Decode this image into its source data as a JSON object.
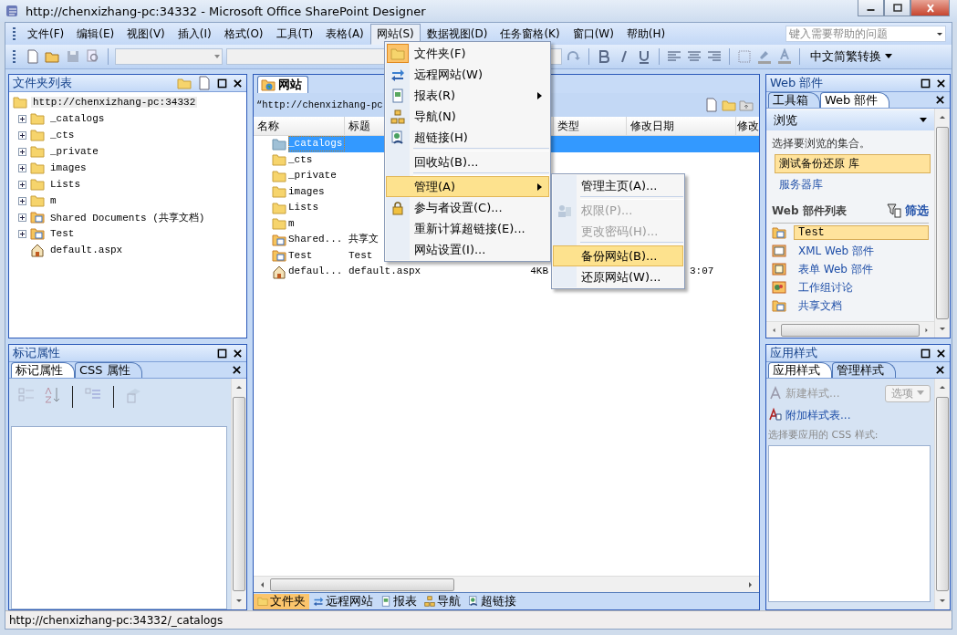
{
  "window": {
    "title": "http://chenxizhang-pc:34332 - Microsoft Office SharePoint Designer"
  },
  "menu_bar": {
    "items": [
      {
        "label": "文件(F)",
        "selected": false
      },
      {
        "label": "编辑(E)",
        "selected": false
      },
      {
        "label": "视图(V)",
        "selected": false
      },
      {
        "label": "插入(I)",
        "selected": false
      },
      {
        "label": "格式(O)",
        "selected": false
      },
      {
        "label": "工具(T)",
        "selected": false
      },
      {
        "label": "表格(A)",
        "selected": false
      },
      {
        "label": "网站(S)",
        "selected": true
      },
      {
        "label": "数据视图(D)",
        "selected": false
      },
      {
        "label": "任务窗格(K)",
        "selected": false
      },
      {
        "label": "窗口(W)",
        "selected": false
      },
      {
        "label": "帮助(H)",
        "selected": false
      }
    ],
    "help_search": {
      "placeholder": "键入需要帮助的问题"
    }
  },
  "toolbar": {
    "language_button": "中文简繁转换"
  },
  "folder_list": {
    "title": "文件夹列表",
    "tree": {
      "label": "http://chenxizhang-pc:34332",
      "selected": true,
      "children": [
        {
          "label": "_catalogs",
          "kind": "folder",
          "expanded": false
        },
        {
          "label": "_cts",
          "kind": "folder",
          "expanded": false
        },
        {
          "label": "_private",
          "kind": "folder",
          "expanded": false
        },
        {
          "label": "images",
          "kind": "folder",
          "expanded": false
        },
        {
          "label": "Lists",
          "kind": "folder",
          "expanded": false
        },
        {
          "label": "m",
          "kind": "folder",
          "expanded": false
        },
        {
          "label": "Shared Documents (共享文档)",
          "kind": "library",
          "expanded": false
        },
        {
          "label": "Test",
          "kind": "library",
          "expanded": false
        },
        {
          "label": "default.aspx",
          "kind": "page"
        }
      ]
    }
  },
  "tag_properties": {
    "title": "标记属性",
    "tabs": [
      {
        "label": "标记属性",
        "selected": true
      },
      {
        "label": "CSS 属性",
        "selected": false
      }
    ]
  },
  "site_view": {
    "tab": "网站",
    "path": "“http://chenxizhang-pc",
    "columns": [
      {
        "label": "名称"
      },
      {
        "label": "标题"
      },
      {
        "label": "类型"
      },
      {
        "label": "修改日期"
      },
      {
        "label": "修改"
      }
    ],
    "rows": [
      {
        "name": "_catalogs",
        "kind": "hidden-folder",
        "selected": true
      },
      {
        "name": "_cts",
        "kind": "folder",
        "selected": false
      },
      {
        "name": "_private",
        "kind": "folder",
        "selected": false
      },
      {
        "name": "images",
        "kind": "folder",
        "selected": false
      },
      {
        "name": "Lists",
        "kind": "folder",
        "selected": false
      },
      {
        "name": "m",
        "kind": "folder",
        "selected": false
      },
      {
        "name": "Shared...",
        "title": "共享文",
        "kind": "library",
        "selected": false
      },
      {
        "name": "Test",
        "title": "Test",
        "kind": "library",
        "selected": false
      },
      {
        "name": "defaul...",
        "title": "default.aspx",
        "size": "4KB",
        "date": "3:07",
        "kind": "page",
        "selected": false
      }
    ],
    "view_tabs": [
      {
        "label": "文件夹",
        "kind": "folder",
        "selected": true
      },
      {
        "label": "远程网站",
        "kind": "remote",
        "selected": false
      },
      {
        "label": "报表",
        "kind": "report",
        "selected": false
      },
      {
        "label": "导航",
        "kind": "nav",
        "selected": false
      },
      {
        "label": "超链接",
        "kind": "link",
        "selected": false
      }
    ]
  },
  "site_menu": {
    "items": [
      {
        "label": "文件夹(F)",
        "kind": "folder",
        "checked": true,
        "highlighted": false,
        "submenu": false
      },
      {
        "label": "远程网站(W)",
        "kind": "remote",
        "checked": false,
        "highlighted": false,
        "submenu": false
      },
      {
        "label": "报表(R)",
        "kind": "report",
        "checked": false,
        "highlighted": false,
        "submenu": true
      },
      {
        "label": "导航(N)",
        "kind": "nav",
        "checked": false,
        "highlighted": false,
        "submenu": false
      },
      {
        "label": "超链接(H)",
        "kind": "link",
        "checked": false,
        "highlighted": false,
        "submenu": false
      },
      {
        "kind": "separator"
      },
      {
        "label": "回收站(B)...",
        "kind": "plain",
        "checked": false,
        "highlighted": false,
        "submenu": false
      },
      {
        "kind": "separator"
      },
      {
        "label": "管理(A)",
        "kind": "plain",
        "checked": false,
        "highlighted": true,
        "submenu": true
      },
      {
        "label": "参与者设置(C)...",
        "kind": "lock",
        "checked": false,
        "highlighted": false,
        "submenu": false
      },
      {
        "label": "重新计算超链接(E)...",
        "kind": "plain",
        "checked": false,
        "highlighted": false,
        "submenu": false
      },
      {
        "label": "网站设置(I)...",
        "kind": "plain",
        "checked": false,
        "highlighted": false,
        "submenu": false
      }
    ]
  },
  "manage_submenu": {
    "items": [
      {
        "label": "管理主页(A)...",
        "kind": "plain",
        "disabled": false,
        "highlighted": false
      },
      {
        "kind": "separator"
      },
      {
        "label": "权限(P)...",
        "kind": "people",
        "disabled": true,
        "highlighted": false
      },
      {
        "label": "更改密码(H)...",
        "kind": "plain",
        "disabled": true,
        "highlighted": false
      },
      {
        "kind": "separator"
      },
      {
        "label": "备份网站(B)...",
        "kind": "plain",
        "disabled": false,
        "highlighted": true
      },
      {
        "label": "还原网站(W)...",
        "kind": "plain",
        "disabled": false,
        "highlighted": false
      }
    ]
  },
  "web_parts": {
    "title": "Web 部件",
    "tabs": [
      {
        "label": "工具箱",
        "selected": false
      },
      {
        "label": "Web 部件",
        "selected": true
      }
    ],
    "browse": "浏览",
    "prompt": "选择要浏览的集合。",
    "collections": [
      {
        "label": "测试备份还原 库",
        "selected": true
      },
      {
        "label": "服务器库",
        "selected": false
      }
    ],
    "list_title": "Web 部件列表",
    "filter": "筛选",
    "parts": [
      {
        "label": "Test",
        "kind": "library",
        "selected": true
      },
      {
        "label": "XML Web 部件",
        "kind": "xml",
        "selected": false
      },
      {
        "label": "表单 Web 部件",
        "kind": "form",
        "selected": false
      },
      {
        "label": "工作组讨论",
        "kind": "discussion",
        "selected": false
      },
      {
        "label": "共享文档",
        "kind": "library",
        "selected": false
      }
    ]
  },
  "apply_styles": {
    "title": "应用样式",
    "tabs": [
      {
        "label": "应用样式",
        "selected": true
      },
      {
        "label": "管理样式",
        "selected": false
      }
    ],
    "new_style": {
      "label": "新建样式...",
      "disabled": true
    },
    "options": {
      "label": "选项",
      "disabled": true
    },
    "attach": "附加样式表...",
    "prompt": "选择要应用的 CSS 样式:"
  },
  "status_bar": {
    "text": "http://chenxizhang-pc:34332/_catalogs"
  }
}
